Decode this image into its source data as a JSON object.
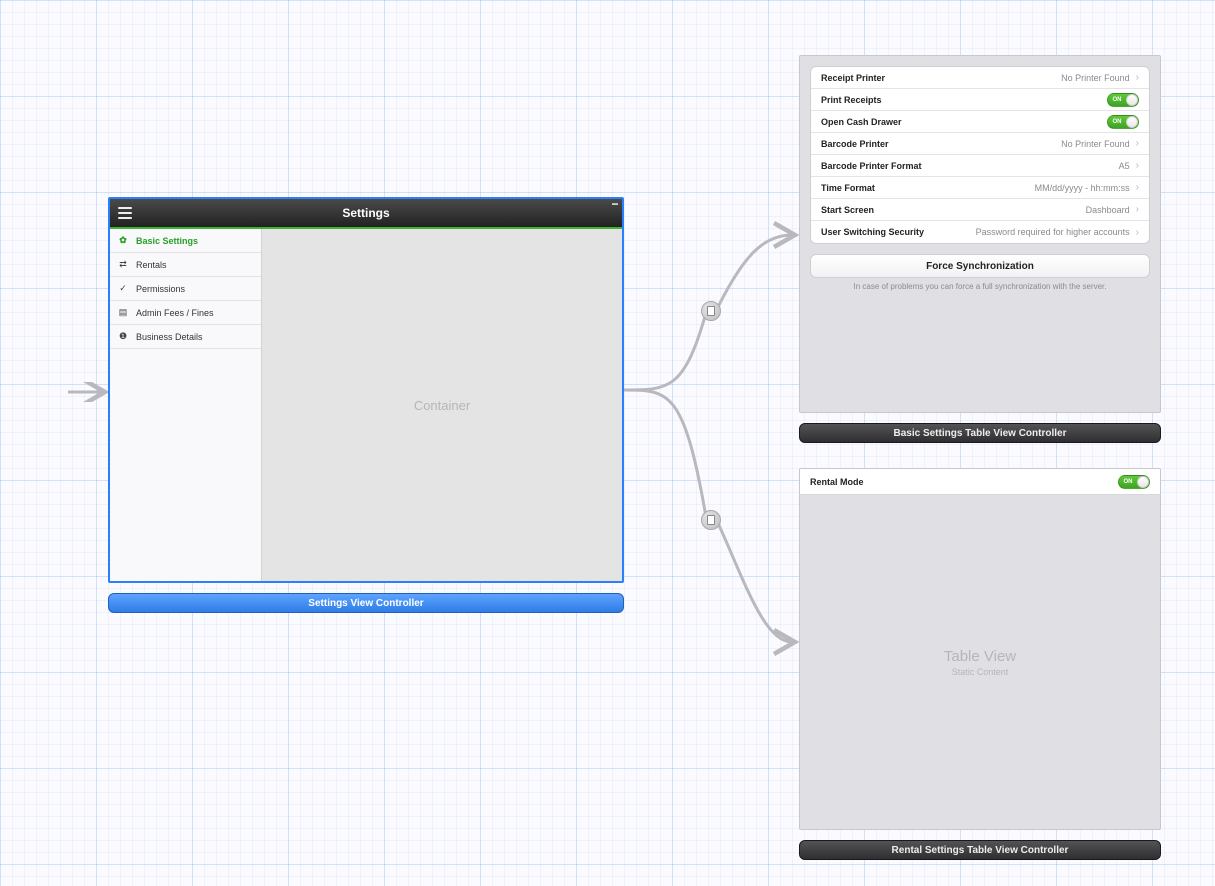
{
  "settings_scene": {
    "title": "Settings",
    "label": "Settings View Controller",
    "container_text": "Container",
    "sidebar": [
      {
        "label": "Basic Settings",
        "icon": "gear-icon"
      },
      {
        "label": "Rentals",
        "icon": "shuffle-icon"
      },
      {
        "label": "Permissions",
        "icon": "check-icon"
      },
      {
        "label": "Admin Fees / Fines",
        "icon": "list-icon"
      },
      {
        "label": "Business Details",
        "icon": "info-icon"
      }
    ]
  },
  "basic_scene": {
    "label": "Basic Settings Table View Controller",
    "rows": {
      "receipt_printer": {
        "label": "Receipt Printer",
        "value": "No Printer Found"
      },
      "print_receipts": {
        "label": "Print Receipts",
        "toggle": "ON"
      },
      "open_drawer": {
        "label": "Open Cash Drawer",
        "toggle": "ON"
      },
      "barcode_printer": {
        "label": "Barcode Printer",
        "value": "No Printer Found"
      },
      "barcode_format": {
        "label": "Barcode Printer Format",
        "value": "A5"
      },
      "time_format": {
        "label": "Time Format",
        "value": "MM/dd/yyyy - hh:mm:ss"
      },
      "start_screen": {
        "label": "Start Screen",
        "value": "Dashboard"
      },
      "user_switching": {
        "label": "User Switching Security",
        "value": "Password required for higher accounts"
      }
    },
    "sync_button": "Force Synchronization",
    "footer": "In case of problems you can force a full synchronization with the server."
  },
  "rental_scene": {
    "label": "Rental Settings Table View Controller",
    "row": {
      "label": "Rental Mode",
      "toggle": "ON"
    },
    "placeholder_title": "Table View",
    "placeholder_sub": "Static Content"
  }
}
